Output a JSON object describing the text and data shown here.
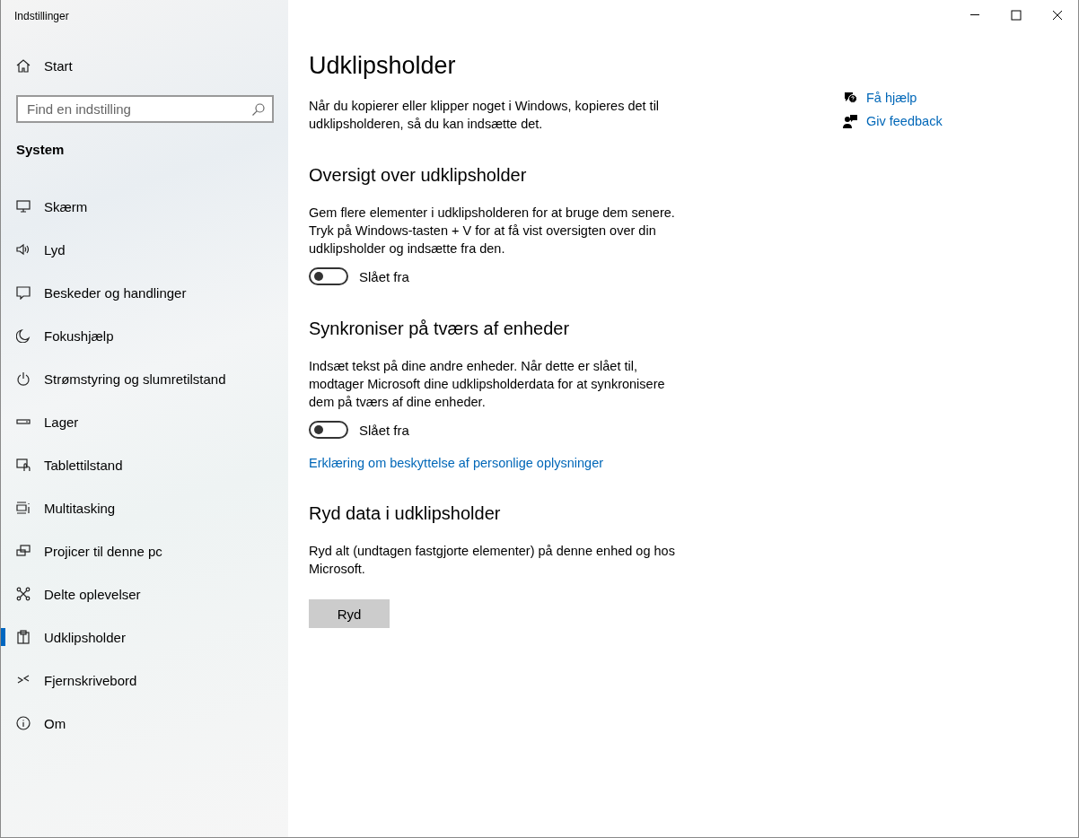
{
  "window": {
    "title": "Indstillinger"
  },
  "sidebar": {
    "home": {
      "label": "Start"
    },
    "search": {
      "placeholder": "Find en indstilling"
    },
    "section": "System",
    "items": [
      {
        "label": "Skærm",
        "selected": false
      },
      {
        "label": "Lyd",
        "selected": false
      },
      {
        "label": "Beskeder og handlinger",
        "selected": false
      },
      {
        "label": "Fokushjælp",
        "selected": false
      },
      {
        "label": "Strømstyring og slumretilstand",
        "selected": false
      },
      {
        "label": "Lager",
        "selected": false
      },
      {
        "label": "Tablettilstand",
        "selected": false
      },
      {
        "label": "Multitasking",
        "selected": false
      },
      {
        "label": "Projicer til denne pc",
        "selected": false
      },
      {
        "label": "Delte oplevelser",
        "selected": false
      },
      {
        "label": "Udklipsholder",
        "selected": true
      },
      {
        "label": "Fjernskrivebord",
        "selected": false
      },
      {
        "label": "Om",
        "selected": false
      }
    ]
  },
  "page": {
    "title": "Udklipsholder",
    "intro": "Når du kopierer eller klipper noget i Windows, kopieres det til udklipsholderen, så du kan indsætte det.",
    "sections": [
      {
        "heading": "Oversigt over udklipsholder",
        "text": "Gem flere elementer i udklipsholderen for at bruge dem senere. Tryk på Windows-tasten + V for at få vist oversigten over din udklipsholder og indsætte fra den.",
        "toggle": {
          "on": false,
          "label": "Slået fra"
        }
      },
      {
        "heading": "Synkroniser på tværs af enheder",
        "text": "Indsæt tekst på dine andre enheder. Når dette er slået til, modtager Microsoft dine udklipsholderdata for at synkronisere dem på tværs af dine enheder.",
        "toggle": {
          "on": false,
          "label": "Slået fra"
        },
        "link": "Erklæring om beskyttelse af personlige oplysninger"
      },
      {
        "heading": "Ryd data i udklipsholder",
        "text": "Ryd alt (undtagen fastgjorte elementer) på denne enhed og hos Microsoft.",
        "button": "Ryd"
      }
    ]
  },
  "help_links": [
    {
      "label": "Få hjælp"
    },
    {
      "label": "Giv feedback"
    }
  ]
}
